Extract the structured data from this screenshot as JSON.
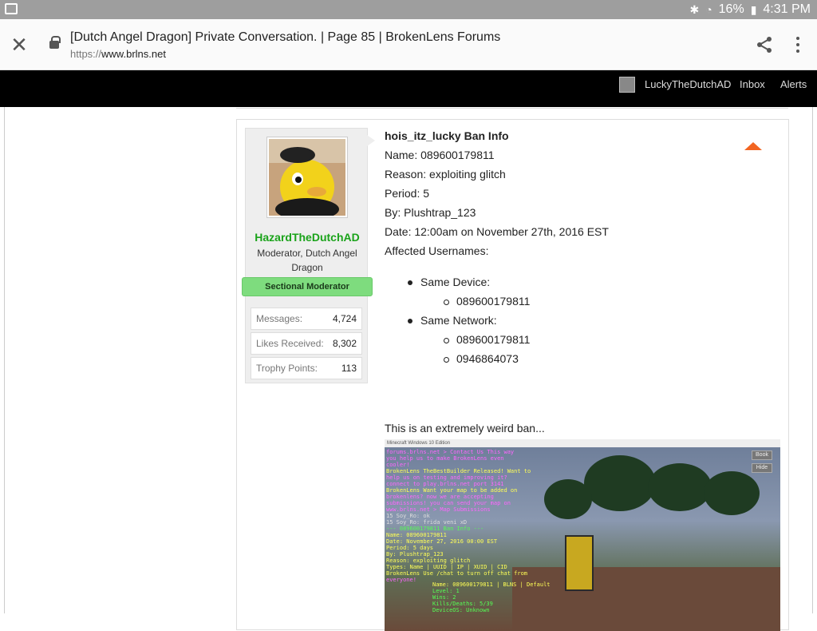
{
  "status_bar": {
    "battery": "16%",
    "time": "4:31 PM"
  },
  "browser": {
    "page_title": "[Dutch Angel Dragon] Private Conversation. | Page 85 | BrokenLens Forums",
    "url_scheme": "https://",
    "url_host": "www.brlns.net"
  },
  "site_nav": {
    "username": "LuckyTheDutchAD",
    "inbox": "Inbox",
    "alerts": "Alerts"
  },
  "user": {
    "name": "HazardTheDutchAD",
    "title": "Moderator, Dutch Angel Dragon",
    "role": "Sectional Moderator",
    "stats": [
      {
        "label": "Messages:",
        "value": "4,724"
      },
      {
        "label": "Likes Received:",
        "value": "8,302"
      },
      {
        "label": "Trophy Points:",
        "value": "113"
      }
    ]
  },
  "post": {
    "title": "hois_itz_lucky Ban Info",
    "lines": [
      "Name: 089600179811",
      "Reason: exploiting glitch",
      "Period: 5",
      "By: Plushtrap_123",
      "Date: 12:00am on November 27th, 2016 EST",
      "Affected Usernames:"
    ],
    "same_device_label": "Same Device:",
    "same_device_items": [
      "089600179811"
    ],
    "same_network_label": "Same Network:",
    "same_network_items": [
      "089600179811",
      "0946864073"
    ],
    "comment": "This is an extremely weird ban..."
  },
  "screenshot": {
    "window_title": "Minecraft Windows 10 Edition",
    "btn_book": "Book",
    "btn_hide": "Hide",
    "chat": [
      {
        "text": "forums.brlns.net > Contact Us This way",
        "color": "#ff66ff"
      },
      {
        "text": "you help us to make BrokenLens even",
        "color": "#ff66ff"
      },
      {
        "text": "cooler!",
        "color": "#ff66ff"
      },
      {
        "text": "BrokenLens TheBestBuilder Released! Want to",
        "color": "#ffff55"
      },
      {
        "text": "help us on testing and improving it?",
        "color": "#ff66ff"
      },
      {
        "text": "connect to play.brlns.net port 3141",
        "color": "#ff66ff"
      },
      {
        "text": "BrokenLens Want your map to be added on",
        "color": "#ffff55"
      },
      {
        "text": "brokenlens? now we are accepting",
        "color": "#ff66ff"
      },
      {
        "text": "submissions! you can send your map on",
        "color": "#ff66ff"
      },
      {
        "text": "www.brlns.net > Map Submissions",
        "color": "#ff66ff"
      },
      {
        "text": "15 Soy_Ro: ok",
        "color": "#dddddd"
      },
      {
        "text": "15 Soy_Ro: frida veni xD",
        "color": "#dddddd"
      },
      {
        "text": "--- 089600179811 Ban Info ---",
        "color": "#55ff55"
      },
      {
        "text": "Name: 089600179811",
        "color": "#ffff55"
      },
      {
        "text": "Date: November 27, 2016 00:00 EST",
        "color": "#ffff55"
      },
      {
        "text": "Period: 5 days",
        "color": "#ffff55"
      },
      {
        "text": "By: Plushtrap_123",
        "color": "#ffff55"
      },
      {
        "text": "Reason: exploiting glitch",
        "color": "#ffff55"
      },
      {
        "text": "Types: Name | UUID | IP | XUID | CID",
        "color": "#ffff55"
      },
      {
        "text": "BrokenLens Use /chat to turn off chat from",
        "color": "#ffff55"
      },
      {
        "text": "everyone!",
        "color": "#ff66ff"
      }
    ],
    "hud": [
      {
        "text": "Name: 089600179811 | BLNS | Default",
        "color": "#ffff55"
      },
      {
        "text": "Level: 1",
        "color": "#55ff55"
      },
      {
        "text": "Wins: 2",
        "color": "#55ff55"
      },
      {
        "text": "Kills/Deaths: 5/39",
        "color": "#55ff55"
      },
      {
        "text": "DeviceOS: Unknown",
        "color": "#55ff55"
      }
    ]
  }
}
